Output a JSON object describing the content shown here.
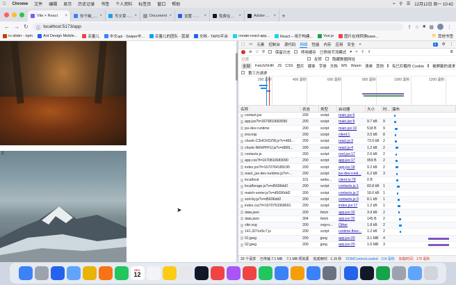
{
  "menubar": {
    "apple": "",
    "app": "Chrome",
    "items": [
      "文件",
      "编辑",
      "显示",
      "历史记录",
      "书签",
      "个人资料",
      "标签页",
      "窗口",
      "帮助"
    ],
    "datetime": "12月12日 周一 10:42"
  },
  "tabs": [
    {
      "title": "Vite + React",
      "color": "#7b5cf0",
      "active": true
    },
    {
      "title": "你干嘛_哎哟_的个人",
      "color": "#3b82f6"
    },
    {
      "title": "写文章 - React实现",
      "color": "#0ea5e9"
    },
    {
      "title": "Document",
      "color": "#999999"
    },
    {
      "title": "设置 - 隐私设置和安",
      "color": "#2563eb"
    },
    {
      "title": "免费在线转换视频和",
      "color": "#111827"
    },
    {
      "title": "Adobe Express",
      "color": "#111827"
    }
  ],
  "toolbar": {
    "url": "localhost:5173/app"
  },
  "bookmarks": [
    {
      "label": "rc-slider - npm",
      "color": "#c2410c"
    },
    {
      "label": "Ant Design Mobile...",
      "color": "#2563eb"
    },
    {
      "label": "买量儿",
      "color": "#ef4444"
    },
    {
      "label": "中文api - Swiper中...",
      "color": "#3b82f6"
    },
    {
      "label": "买量儿的团队 - 蓝湖",
      "color": "#0ea5e9"
    },
    {
      "label": "文档 - TAPD平台",
      "color": "#2563eb"
    },
    {
      "label": "create-react-app...",
      "color": "#22d3ee"
    },
    {
      "label": "React – 用于构建...",
      "color": "#22d3ee"
    },
    {
      "label": "Vue.js",
      "color": "#16a34a"
    },
    {
      "label": "图片在线转换base...",
      "color": "#ef4444"
    }
  ],
  "bookmarks_more": "其他书签",
  "page": {
    "image2_label": "2"
  },
  "devtools": {
    "tabs": [
      "元素",
      "控制台",
      "源代码",
      "网络",
      "性能",
      "内存",
      "应用",
      "安全"
    ],
    "active_tab": "网络",
    "badge": "1",
    "preserve_log": "保留日志",
    "disable_cache": "停用缓存",
    "throttle": "已停用节流模式",
    "filter_placeholder": "过滤",
    "invert": "反转",
    "hide_data_urls": "隐藏数据网址",
    "filter_types": [
      "全部",
      "Fetch/XHR",
      "JS",
      "CSS",
      "图片",
      "媒体",
      "字体",
      "文档",
      "WS",
      "Wasm",
      "清单",
      "其他"
    ],
    "blocked_cookies": "有已拦截的 Cookie",
    "blocked_requests": "被屏蔽的请求",
    "third_party": "第三方请求",
    "timeline_ticks": [
      "200 毫秒",
      "400 毫秒",
      "600 毫秒",
      "800 毫秒",
      "1000 毫秒",
      "1200 毫秒"
    ],
    "columns": [
      "名称",
      "状态",
      "类型",
      "启动器",
      "大小",
      "时...",
      "瀑布"
    ],
    "requests": [
      {
        "name": "contact.jsx",
        "status": "200",
        "type": "script",
        "init": "main.jsx:6",
        "size": "",
        "time": ""
      },
      {
        "name": "app.jsx?t=1670810683090",
        "status": "200",
        "type": "script",
        "init": "main.jsx:9",
        "size": "9.7 kB",
        "time": "9"
      },
      {
        "name": "jsx-dev-runtime",
        "status": "200",
        "type": "script",
        "init": "main.jsx:10",
        "size": "518 B",
        "time": "9"
      },
      {
        "name": "env.mjs",
        "status": "200",
        "type": "script",
        "init": "client:1",
        "size": "3.5 kB",
        "time": "8"
      },
      {
        "name": "chunk-C3HOXDZW.js?v=d56...",
        "status": "200",
        "type": "script",
        "init": "react.js:3",
        "size": "73.5 kB",
        "time": "2"
      },
      {
        "name": "chunk-NKHPFFU.js?v=d569...",
        "status": "200",
        "type": "script",
        "init": "react.js:4",
        "size": "1.2 kB",
        "time": "2"
      },
      {
        "name": "contacts.js",
        "status": "200",
        "type": "script",
        "init": "root.jsx:17",
        "size": "2.6 kB",
        "time": "2"
      },
      {
        "name": "app.css?t=1670810683090",
        "status": "200",
        "type": "script",
        "init": "app.jsx:17",
        "size": "959 B",
        "time": "2"
      },
      {
        "name": "index.jsx?t=1670764189195",
        "status": "200",
        "type": "script",
        "init": "app.jsx:18",
        "size": "9.2 kB",
        "time": "2"
      },
      {
        "name": "react_jsx-dev-runtime.js?v=...",
        "status": "200",
        "type": "script",
        "init": "jsx-dev-runti...",
        "size": "6.2 kB",
        "time": "3"
      },
      {
        "name": "localhost",
        "status": "101",
        "type": "webs...",
        "init": "client.ts:78",
        "size": "0 B",
        "time": ""
      },
      {
        "name": "localforage.js?v=d5696dd2",
        "status": "200",
        "type": "script",
        "init": "contacts.js:1",
        "size": "83.8 kB",
        "time": "1"
      },
      {
        "name": "match-sorter.js?v=d5696dd2",
        "status": "200",
        "type": "script",
        "init": "contacts.js:2",
        "size": "18.0 kB",
        "time": "1"
      },
      {
        "name": "sort-by.js?v=d5696dd2",
        "status": "200",
        "type": "script",
        "init": "contacts.js:3",
        "size": "8.1 kB",
        "time": "1"
      },
      {
        "name": "index.css?t=1670763368691",
        "status": "200",
        "type": "script",
        "init": "index.jsx:17",
        "size": "1.2 kB",
        "time": "1"
      },
      {
        "name": "data.json",
        "status": "200",
        "type": "fetch",
        "init": "app.jsx:32",
        "size": "3.9 kB",
        "time": "2"
      },
      {
        "name": "data.json",
        "status": "304",
        "type": "fetch",
        "init": "app.jsx:32",
        "size": "145 B",
        "time": "2"
      },
      {
        "name": "vite.svg",
        "status": "200",
        "type": "svg+x...",
        "init": "Other",
        "size": "1.8 kB",
        "time": "2"
      },
      {
        "name": "141.327ce5c7.js",
        "status": "200",
        "type": "script",
        "init": "runtime.fbee...",
        "size": "1.2 kB",
        "time": "2"
      },
      {
        "name": "01.jpeg",
        "status": "200",
        "type": "jpeg",
        "init": "app.jsx:20",
        "size": "3.1 MB",
        "time": "4"
      },
      {
        "name": "02.jpeg",
        "status": "200",
        "type": "jpeg",
        "init": "app.jsx:20",
        "size": "1.6 MB",
        "time": "3"
      }
    ],
    "status_bar": {
      "requests": "33 个请求",
      "transferred": "已传输 7.1 MB",
      "resources": "7.1 MB 项资源",
      "finish": "完成用时：1.15 秒",
      "dcl": "DOMContentLoaded：114 毫秒",
      "load": "加载时间：175 毫秒"
    }
  },
  "dock": {
    "apps": [
      {
        "name": "Finder",
        "color": "#3b82f6"
      },
      {
        "name": "Launchpad",
        "color": "#9ca3af"
      },
      {
        "name": "Safari",
        "color": "#2563eb"
      },
      {
        "name": "Mail",
        "color": "#60a5fa"
      },
      {
        "name": "Chrome",
        "color": "#eab308"
      },
      {
        "name": "Photos",
        "color": "#f97316"
      },
      {
        "name": "FaceTime",
        "color": "#22c55e"
      },
      {
        "name": "Calendar",
        "color": "#ffffff"
      },
      {
        "name": "Reminders",
        "color": "#f3f4f6"
      },
      {
        "name": "Notes",
        "color": "#facc15"
      },
      {
        "name": "Freeform",
        "color": "#e5e7eb"
      },
      {
        "name": "TV",
        "color": "#111827"
      },
      {
        "name": "Music",
        "color": "#ef4444"
      },
      {
        "name": "Podcasts",
        "color": "#a855f7"
      },
      {
        "name": "News",
        "color": "#ef4444"
      },
      {
        "name": "Numbers",
        "color": "#22c55e"
      },
      {
        "name": "Keynote",
        "color": "#3b82f6"
      },
      {
        "name": "Pages",
        "color": "#f59e0b"
      },
      {
        "name": "App Store",
        "color": "#3b82f6"
      },
      {
        "name": "System Settings",
        "color": "#6b7280"
      },
      {
        "name": "VS Code",
        "color": "#2563eb"
      },
      {
        "name": "Terminal",
        "color": "#111827"
      },
      {
        "name": "Chrome Dev",
        "color": "#16a34a"
      },
      {
        "name": "Preview",
        "color": "#9ca3af"
      },
      {
        "name": "Downloads",
        "color": "#60a5fa"
      },
      {
        "name": "Trash",
        "color": "#d1d5db"
      }
    ],
    "calendar_month": "DEC",
    "calendar_day": "12"
  }
}
